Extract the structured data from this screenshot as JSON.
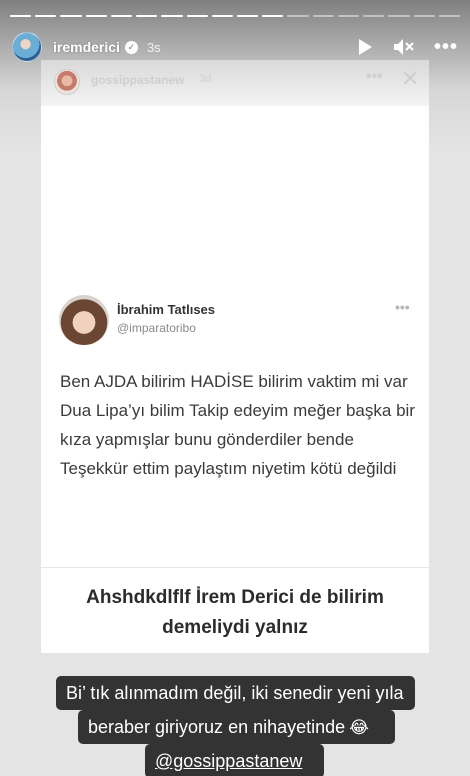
{
  "story": {
    "segments_total": 18,
    "segments_done": 11,
    "username": "iremderici",
    "verified_icon": "verified-badge-icon",
    "time": "3s",
    "controls": {
      "play_icon": "play-icon",
      "mute_icon": "mute-icon",
      "more_icon": "more-icon"
    }
  },
  "shared_post": {
    "username": "gossippastanew",
    "time": "3d",
    "tweet": {
      "name": "İbrahim Tatlıses",
      "handle": "@imparatoribo",
      "text": "Ben AJDA bilirim HADİSE bilirim vaktim mi var Dua Lipa’yı bilim Takip edeyim meğer başka bir kıza yapmışlar bunu gönderdiler bende Teşekkür ettim paylaştım niyetim kötü değildi"
    },
    "overlay_text": "Ahshdkdlflf İrem Derici de bilirim demeliydi yalnız"
  },
  "captions": {
    "line1": "Bi’ tık alınmadım değil, iki senedir yeni yıla",
    "line2": "beraber giriyoruz en nihayetinde",
    "line2_emoji": "😂",
    "mention": "@gossippastanew"
  }
}
